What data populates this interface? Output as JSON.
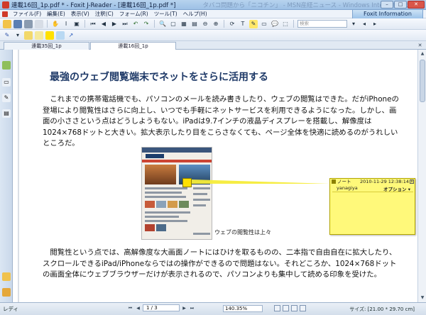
{
  "window": {
    "title": "連載16回_1p.pdf * - Foxit J-Reader - [連載16回_1p.pdf *]",
    "ghost_title": "タバコ問題から「ニコチン」 - MSN産経ニュース - Windows Internet Explorer"
  },
  "menu": {
    "items": [
      "ファイル(F)",
      "編集(E)",
      "表示(V)",
      "注釈(C)",
      "フォーム(R)",
      "ツール(T)",
      "ヘルプ(H)"
    ],
    "info_panel": "Foxit Information"
  },
  "toolbar": {
    "search_placeholder": "検索"
  },
  "tabs": [
    {
      "label": "連載35回_1p"
    },
    {
      "label": "連載16回_1p"
    }
  ],
  "document": {
    "title": "最強のウェブ閲覧端末でネットをさらに活用する",
    "para1": "これまでの携帯電話機でも、パソコンのメールを読み書きしたり、ウェブの閲覧はできた。だがiPhoneの登場により閲覧性はさらに向上し、いつでも手軽にネットサービスを利用できるようになった。しかし、画面の小ささという点はどうしようもない。iPadは9.7インチの液晶ディスプレーを搭載し、解像度は1024×768ドットと大きい。拡大表示したり目をこらさなくても、ページ全体を快適に読めるのがうれしいところだ。",
    "image_caption": "ウェブの閲覧性は上々",
    "para2": "閲覧性という点では、高解像度な大画面ノートにはひけを取るものの、二本指で自由自在に拡大したり、スクロールできるiPad/iPhoneならではの操作ができるので問題はない。それどころか、1024×768ドットの画面全体にウェブブラウザーだけが表示されるので、パソコンよりも集中して読める印象を受けた。"
  },
  "note": {
    "type": "ノート",
    "date": "2010-11-29 12:38:14",
    "author": "yanagiya",
    "options": "オプション ▾",
    "colors": {
      "fill": "#fff97a",
      "line": "#f5ec3a",
      "anchor": "#ffe000"
    }
  },
  "statusbar": {
    "ready": "レディ",
    "page": "1 / 3",
    "zoom": "140.35%",
    "size": "サイズ: [21.00 * 29.70 cm]"
  }
}
